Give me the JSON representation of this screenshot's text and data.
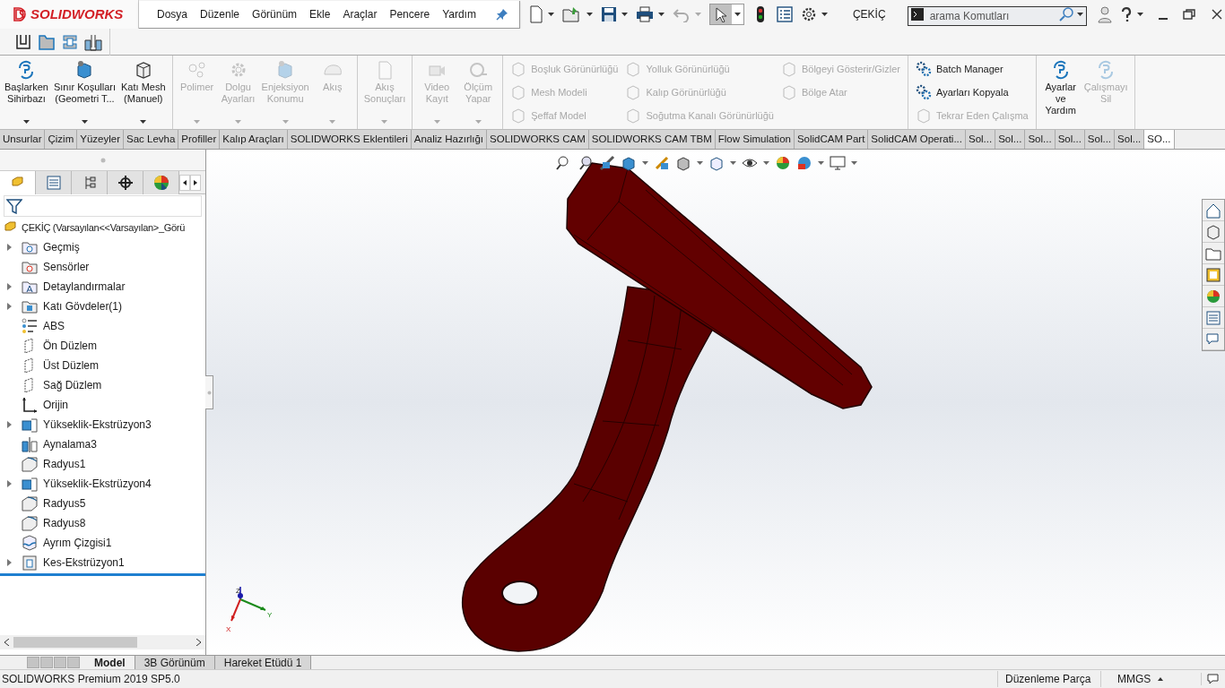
{
  "app": {
    "logo": "SOLIDWORKS"
  },
  "menu": [
    "Dosya",
    "Düzenle",
    "Görünüm",
    "Ekle",
    "Araçlar",
    "Pencere",
    "Yardım"
  ],
  "document_title": "ÇEKİÇ",
  "search": {
    "placeholder": "arama Komutları"
  },
  "ribbon": [
    {
      "kind": "large",
      "items": [
        {
          "label": "Başlarken\nSihirbazı",
          "disabled": false,
          "dropdown": true
        },
        {
          "label": "Sınır Koşulları\n(Geometri T...",
          "disabled": false,
          "dropdown": true
        },
        {
          "label": "Katı Mesh\n(Manuel)",
          "disabled": false,
          "dropdown": true
        }
      ]
    },
    {
      "kind": "large",
      "items": [
        {
          "label": "Polimer",
          "disabled": true,
          "dropdown": true
        },
        {
          "label": "Dolgu\nAyarları",
          "disabled": true,
          "dropdown": true
        },
        {
          "label": "Enjeksiyon\nKonumu",
          "disabled": true,
          "dropdown": true
        },
        {
          "label": "Akış",
          "disabled": true,
          "dropdown": true
        }
      ]
    },
    {
      "kind": "large",
      "items": [
        {
          "label": "Akış\nSonuçları",
          "disabled": true,
          "dropdown": true
        }
      ]
    },
    {
      "kind": "large",
      "items": [
        {
          "label": "Video\nKayıt",
          "disabled": true,
          "dropdown": true
        },
        {
          "label": "Ölçüm\nYapar",
          "disabled": true,
          "dropdown": true
        }
      ]
    },
    {
      "kind": "small",
      "columns": [
        [
          {
            "label": "Boşluk Görünürlüğü",
            "disabled": true
          },
          {
            "label": "Mesh Modeli",
            "disabled": true
          },
          {
            "label": "Şeffaf Model",
            "disabled": true
          }
        ],
        [
          {
            "label": "Yolluk Görünürlüğü",
            "disabled": true
          },
          {
            "label": "Kalıp Görünürlüğü",
            "disabled": true
          },
          {
            "label": "Soğutma Kanalı Görünürlüğü",
            "disabled": true
          }
        ],
        [
          {
            "label": "Bölgeyi Gösterir/Gizler",
            "disabled": true
          },
          {
            "label": "Bölge Atar",
            "disabled": true
          }
        ]
      ]
    },
    {
      "kind": "small",
      "columns": [
        [
          {
            "label": "Batch Manager",
            "disabled": false
          },
          {
            "label": "Ayarları Kopyala",
            "disabled": false
          },
          {
            "label": "Tekrar Eden Çalışma",
            "disabled": true
          }
        ]
      ]
    },
    {
      "kind": "large",
      "items": [
        {
          "label": "Ayarlar\nve\nYardım",
          "disabled": false,
          "dropdown": false
        },
        {
          "label": "Çalışmayı\nSil",
          "disabled": true,
          "dropdown": false
        }
      ]
    }
  ],
  "command_tabs": [
    {
      "label": "Unsurlar",
      "selected": false
    },
    {
      "label": "Çizim",
      "selected": false
    },
    {
      "label": "Yüzeyler",
      "selected": false
    },
    {
      "label": "Sac Levha",
      "selected": false
    },
    {
      "label": "Profiller",
      "selected": false
    },
    {
      "label": "Kalıp Araçları",
      "selected": false
    },
    {
      "label": "SOLIDWORKS Eklentileri",
      "selected": false
    },
    {
      "label": "Analiz Hazırlığı",
      "selected": false
    },
    {
      "label": "SOLIDWORKS CAM",
      "selected": false
    },
    {
      "label": "SOLIDWORKS CAM TBM",
      "selected": false
    },
    {
      "label": "Flow Simulation",
      "selected": false
    },
    {
      "label": "SolidCAM Part",
      "selected": false
    },
    {
      "label": "SolidCAM Operati...",
      "selected": false
    },
    {
      "label": "Sol...",
      "selected": false
    },
    {
      "label": "Sol...",
      "selected": false
    },
    {
      "label": "Sol...",
      "selected": false
    },
    {
      "label": "Sol...",
      "selected": false
    },
    {
      "label": "Sol...",
      "selected": false
    },
    {
      "label": "Sol...",
      "selected": false
    },
    {
      "label": "SO...",
      "selected": true
    }
  ],
  "panel_tabs": [
    {
      "selected": true
    },
    {
      "selected": false
    },
    {
      "selected": false
    },
    {
      "selected": false
    },
    {
      "selected": false
    }
  ],
  "feature_tree": {
    "root": "ÇEKİÇ  (Varsayılan<<Varsayılan>_Görü",
    "items": [
      {
        "label": "Geçmiş",
        "kind": "history",
        "has_children": true
      },
      {
        "label": "Sensörler",
        "kind": "sensor",
        "has_children": false
      },
      {
        "label": "Detaylandırmalar",
        "kind": "annotation",
        "has_children": true
      },
      {
        "label": "Katı Gövdeler(1)",
        "kind": "bodies",
        "has_children": true
      },
      {
        "label": "ABS",
        "kind": "material",
        "has_children": false
      },
      {
        "label": "Ön Düzlem",
        "kind": "plane",
        "has_children": false
      },
      {
        "label": "Üst Düzlem",
        "kind": "plane",
        "has_children": false
      },
      {
        "label": "Sağ Düzlem",
        "kind": "plane",
        "has_children": false
      },
      {
        "label": "Orijin",
        "kind": "origin",
        "has_children": false
      },
      {
        "label": "Yükseklik-Ekstrüzyon3",
        "kind": "extrude",
        "has_children": true
      },
      {
        "label": "Aynalama3",
        "kind": "mirror",
        "has_children": false
      },
      {
        "label": "Radyus1",
        "kind": "fillet",
        "has_children": false
      },
      {
        "label": "Yükseklik-Ekstrüzyon4",
        "kind": "extrude",
        "has_children": true
      },
      {
        "label": "Radyus5",
        "kind": "fillet",
        "has_children": false
      },
      {
        "label": "Radyus8",
        "kind": "fillet",
        "has_children": false
      },
      {
        "label": "Ayrım Çizgisi1",
        "kind": "split",
        "has_children": false
      },
      {
        "label": "Kes-Ekstrüzyon1",
        "kind": "cut",
        "has_children": true
      }
    ]
  },
  "triad": {
    "x": "X",
    "y": "Y",
    "z": "Z"
  },
  "bottom_tabs": [
    {
      "label": "Model",
      "selected": true
    },
    {
      "label": "3B Görünüm",
      "selected": false
    },
    {
      "label": "Hareket Etüdü 1",
      "selected": false
    }
  ],
  "status_bar": {
    "product": "SOLIDWORKS Premium 2019 SP5.0",
    "mode": "Düzenleme Parça",
    "units": "MMGS"
  }
}
